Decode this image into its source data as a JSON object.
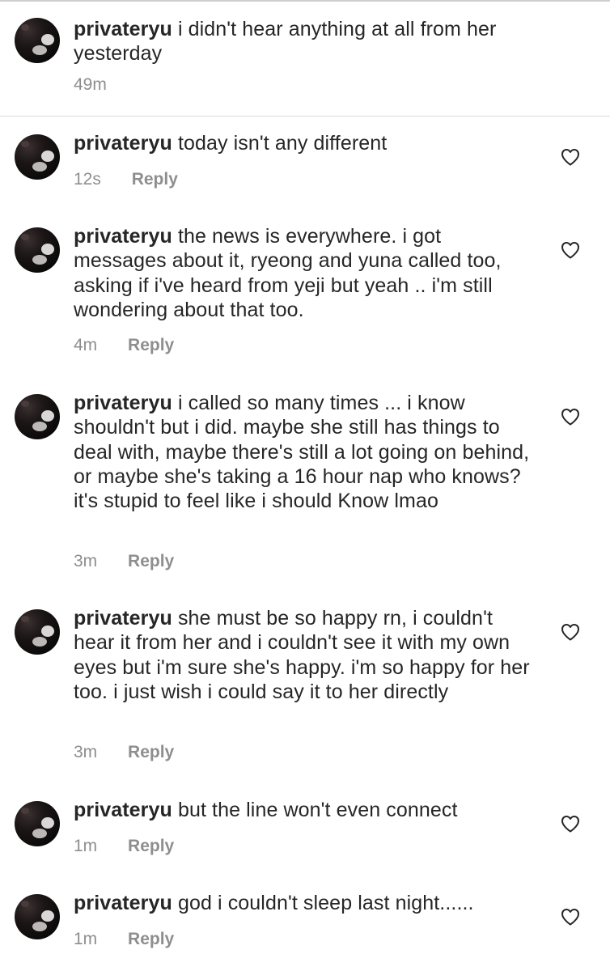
{
  "caption": {
    "username": "privateryu",
    "text": "i didn't hear anything at all from her yesterday",
    "time": "49m"
  },
  "comments": [
    {
      "username": "privateryu",
      "text": "today isn't any different",
      "time": "12s",
      "reply_label": "Reply",
      "like_icon": "heart-outline-icon"
    },
    {
      "username": "privateryu",
      "text": "the news is everywhere. i got messages about it, ryeong and yuna called too, asking if i've heard from yeji but yeah .. i'm still wondering about that too.",
      "time": "4m",
      "reply_label": "Reply",
      "like_icon": "heart-outline-icon"
    },
    {
      "username": "privateryu",
      "text": "i called so many times ... i know shouldn't but i did. maybe she still has things to deal with, maybe there's still a lot going on behind, or maybe she's taking a 16 hour nap who knows? it's stupid to feel like i should Know lmao",
      "time": "3m",
      "reply_label": "Reply",
      "like_icon": "heart-outline-icon"
    },
    {
      "username": "privateryu",
      "text": "she must be so happy rn, i couldn't hear it from her and i couldn't see it with my own eyes but i'm sure she's happy. i'm so happy for her too. i just wish i could say it to her directly",
      "time": "3m",
      "reply_label": "Reply",
      "like_icon": "heart-outline-icon"
    },
    {
      "username": "privateryu",
      "text": "but the line won't even connect",
      "time": "1m",
      "reply_label": "Reply",
      "like_icon": "heart-outline-icon"
    },
    {
      "username": "privateryu",
      "text": "god i couldn't sleep last night......",
      "time": "1m",
      "reply_label": "Reply",
      "like_icon": "heart-outline-icon"
    }
  ]
}
